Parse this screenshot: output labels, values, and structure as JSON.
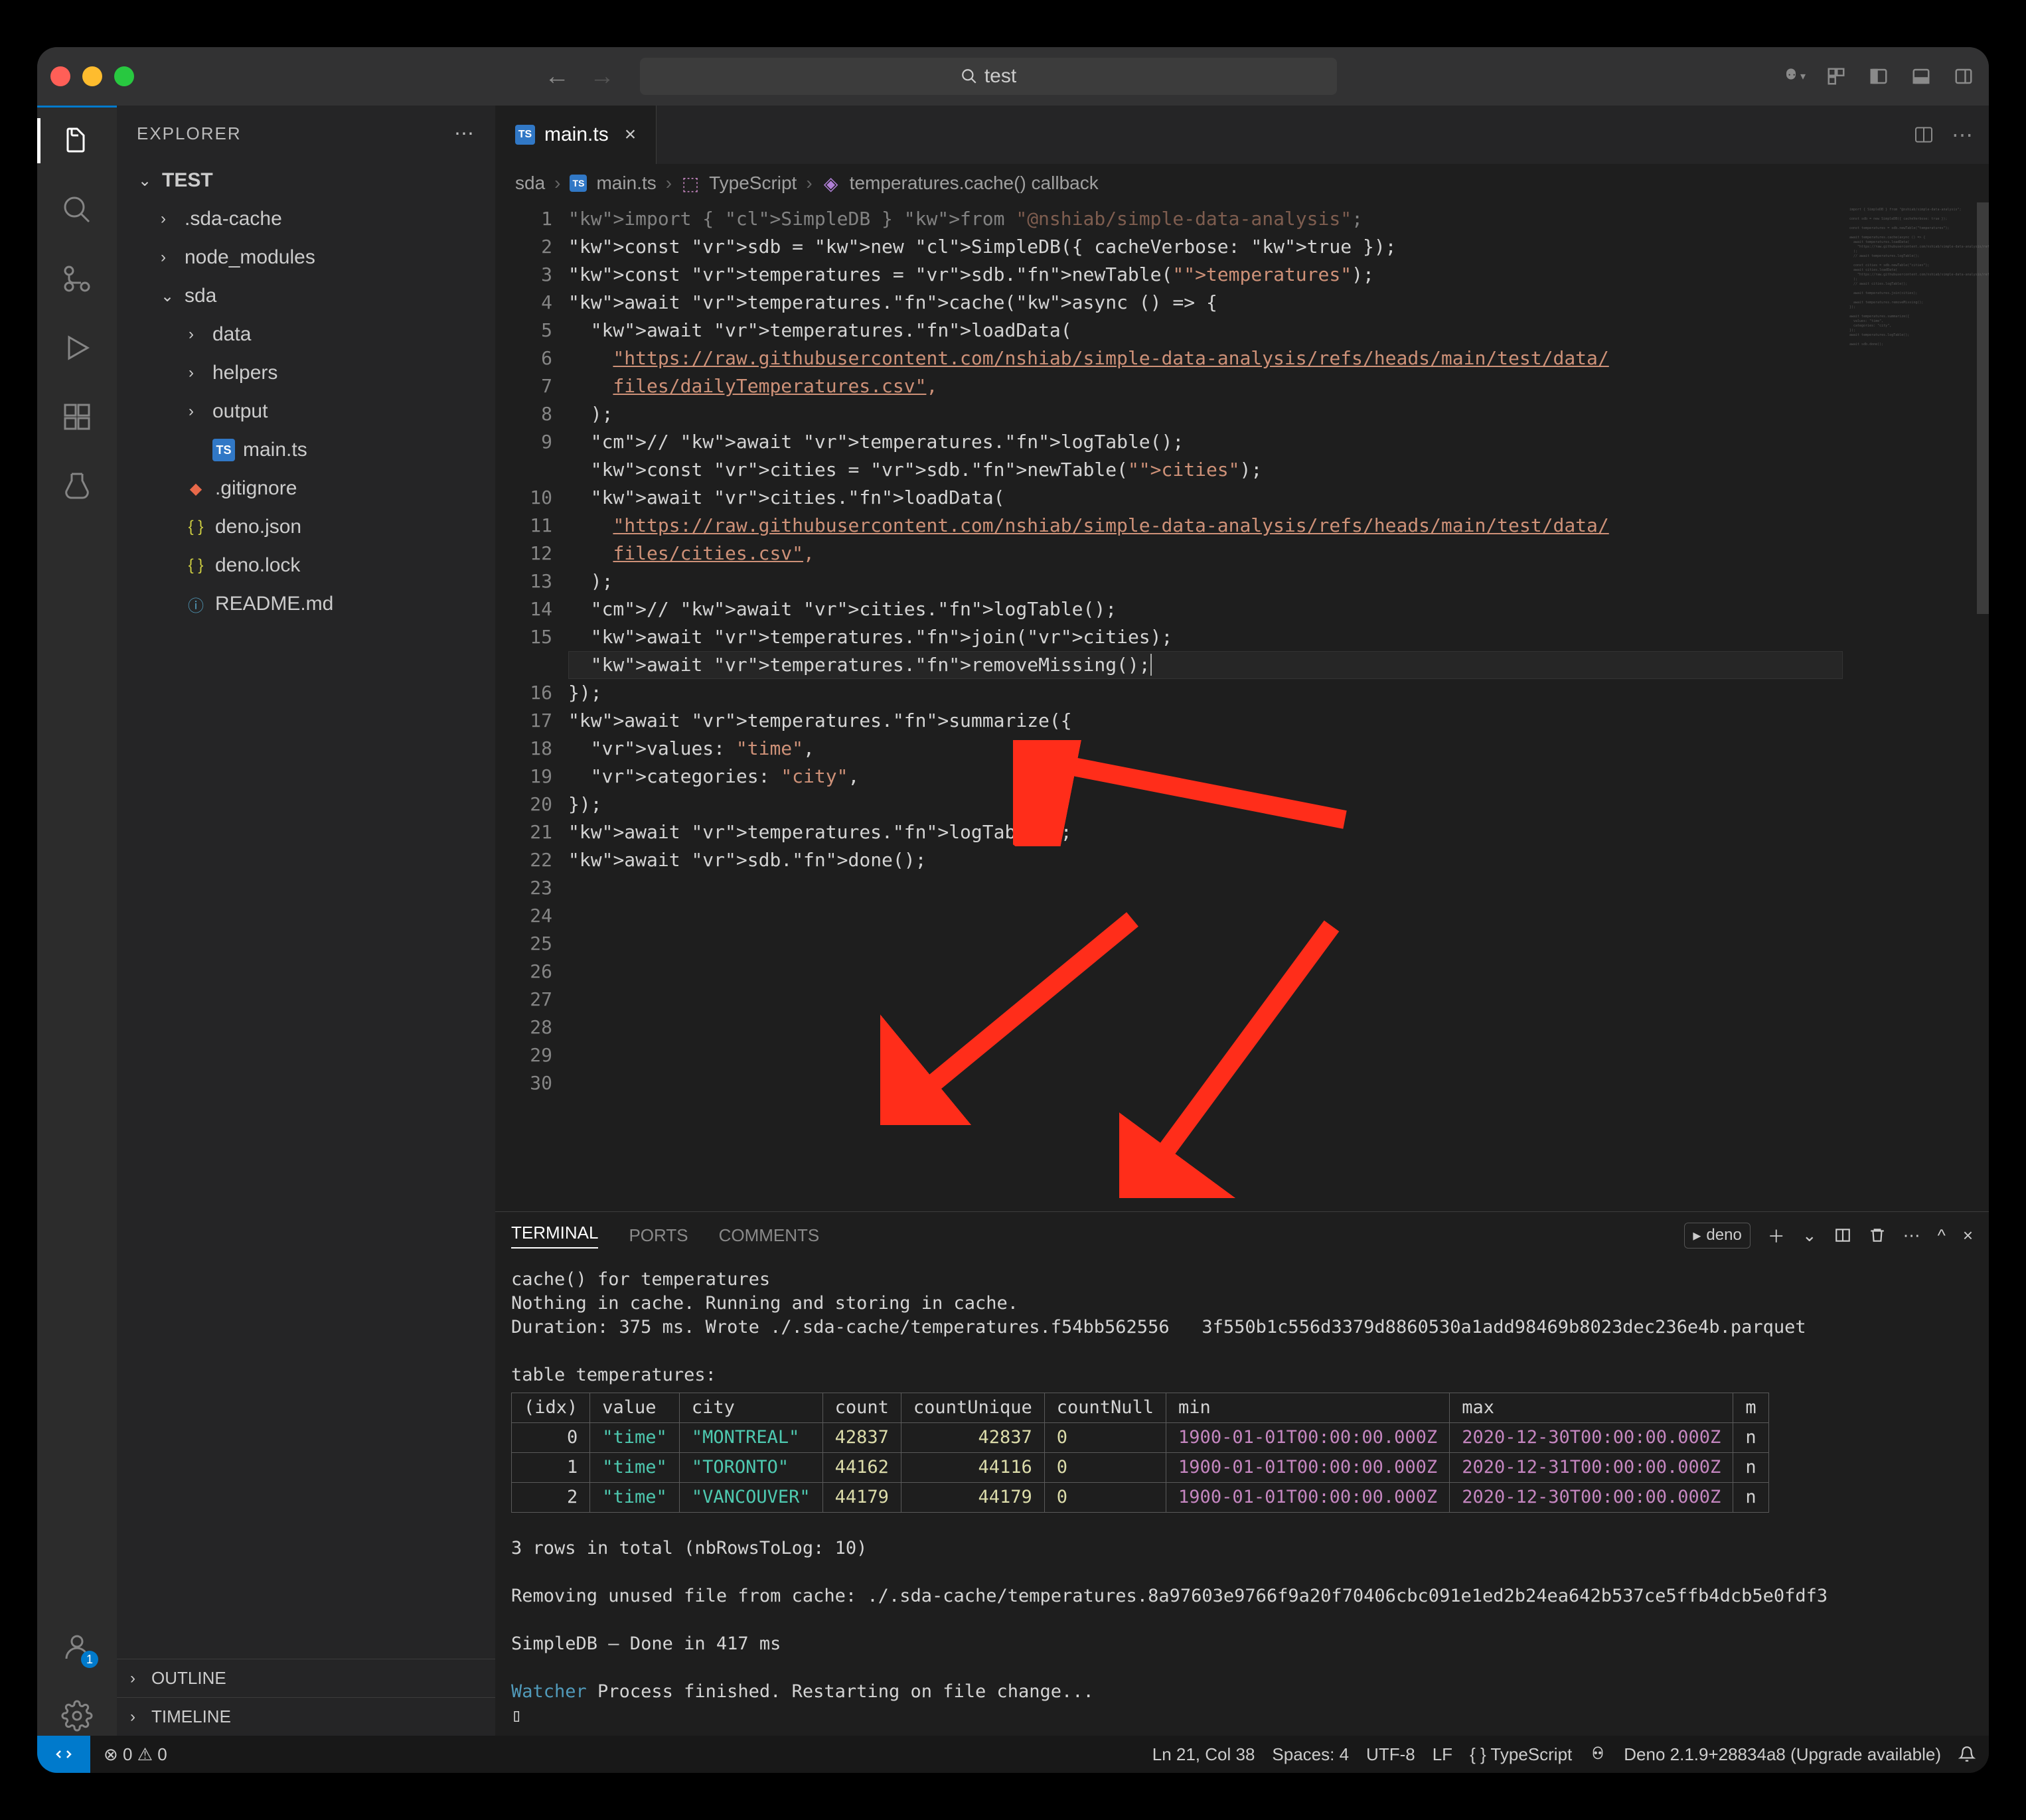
{
  "titlebar": {
    "search_text": "test"
  },
  "sidebar": {
    "title": "EXPLORER",
    "root": "TEST",
    "items": [
      {
        "label": ".sda-cache",
        "type": "folder",
        "depth": 1,
        "open": false
      },
      {
        "label": "node_modules",
        "type": "folder",
        "depth": 1,
        "open": false
      },
      {
        "label": "sda",
        "type": "folder",
        "depth": 1,
        "open": true
      },
      {
        "label": "data",
        "type": "folder",
        "depth": 2,
        "open": false
      },
      {
        "label": "helpers",
        "type": "folder",
        "depth": 2,
        "open": false
      },
      {
        "label": "output",
        "type": "folder",
        "depth": 2,
        "open": false
      },
      {
        "label": "main.ts",
        "type": "ts",
        "depth": 2
      },
      {
        "label": ".gitignore",
        "type": "git",
        "depth": 1
      },
      {
        "label": "deno.json",
        "type": "json",
        "depth": 1
      },
      {
        "label": "deno.lock",
        "type": "json",
        "depth": 1
      },
      {
        "label": "README.md",
        "type": "info",
        "depth": 1
      }
    ],
    "sections": [
      "OUTLINE",
      "TIMELINE"
    ]
  },
  "tabs": {
    "active": {
      "label": "main.ts",
      "icon": "ts"
    }
  },
  "breadcrumbs": [
    "sda",
    "main.ts",
    "TypeScript",
    "temperatures.cache() callback"
  ],
  "code": {
    "start_line": 1,
    "lines": [
      "import { SimpleDB } from \"@nshiab/simple-data-analysis\";",
      "",
      "const sdb = new SimpleDB({ cacheVerbose: true });",
      "",
      "const temperatures = sdb.newTable(\"temperatures\");",
      "",
      "await temperatures.cache(async () => {",
      "  await temperatures.loadData(",
      "    \"https://raw.githubusercontent.com/nshiab/simple-data-analysis/refs/heads/main/test/data/files/dailyTemperatures.csv\",",
      "  );",
      "  // await temperatures.logTable();",
      "",
      "  const cities = sdb.newTable(\"cities\");",
      "  await cities.loadData(",
      "    \"https://raw.githubusercontent.com/nshiab/simple-data-analysis/refs/heads/main/test/data/files/cities.csv\",",
      "  );",
      "  // await cities.logTable();",
      "",
      "  await temperatures.join(cities);",
      "",
      "  await temperatures.removeMissing();",
      "});",
      "",
      "await temperatures.summarize({",
      "  values: \"time\",",
      "  categories: \"city\",",
      "});",
      "await temperatures.logTable();",
      "",
      "await sdb.done();"
    ]
  },
  "panel": {
    "tabs": [
      "TERMINAL",
      "PORTS",
      "COMMENTS"
    ],
    "profile": "deno",
    "output": {
      "line1": "cache() for temperatures",
      "line2": "Nothing in cache. Running and storing in cache.",
      "line3_prefix": "Duration: 375 ms. Wrote ./.sda-cache/temperatures.f54bb562556",
      "line3_suffix": "3f550b1c556d3379d8860530a1add98469b8023dec236e4b.parquet",
      "table_title": "table temperatures:",
      "table": {
        "headers": [
          "(idx)",
          "value",
          "city",
          "count",
          "countUnique",
          "countNull",
          "min",
          "max",
          "m"
        ],
        "rows": [
          [
            "0",
            "\"time\"",
            "\"MONTREAL\"",
            "42837",
            "42837",
            "0",
            "1900-01-01T00:00:00.000Z",
            "2020-12-30T00:00:00.000Z",
            "n"
          ],
          [
            "1",
            "\"time\"",
            "\"TORONTO\"",
            "44162",
            "44116",
            "0",
            "1900-01-01T00:00:00.000Z",
            "2020-12-31T00:00:00.000Z",
            "n"
          ],
          [
            "2",
            "\"time\"",
            "\"VANCOUVER\"",
            "44179",
            "44179",
            "0",
            "1900-01-01T00:00:00.000Z",
            "2020-12-30T00:00:00.000Z",
            "n"
          ]
        ]
      },
      "rows_total": "3 rows in total (nbRowsToLog: 10)",
      "removing": "Removing unused file from cache: ./.sda-cache/temperatures.8a97603e9766f9a20f70406cbc091e1ed2b24ea642b537ce5ffb4dcb5e0fdf3",
      "done": "SimpleDB — Done in 417 ms",
      "watcher_label": "Watcher",
      "watcher_msg": " Process finished. Restarting on file change...",
      "prompt": "▯"
    }
  },
  "statusbar": {
    "errors": "0",
    "warnings": "0",
    "cursor": "Ln 21, Col 38",
    "spaces": "Spaces: 4",
    "encoding": "UTF-8",
    "eol": "LF",
    "lang": "TypeScript",
    "deno": "Deno 2.1.9+28834a8 (Upgrade available)"
  },
  "accounts_badge": "1"
}
